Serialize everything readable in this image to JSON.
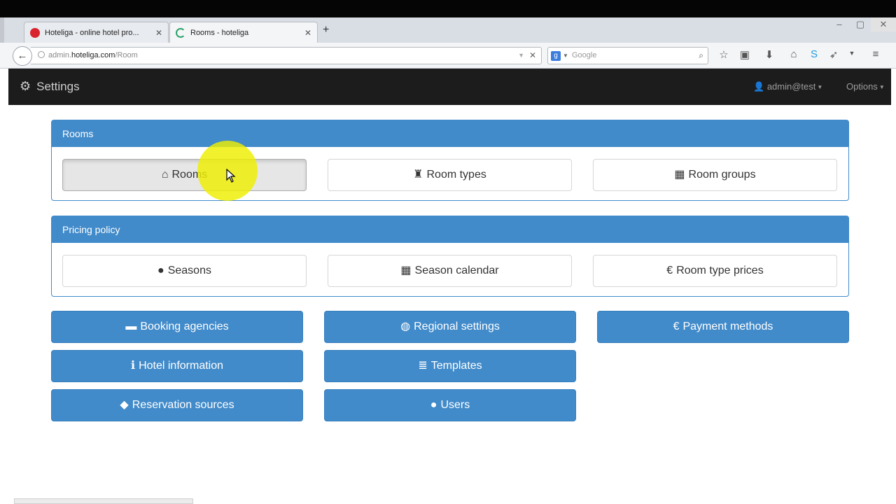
{
  "browser": {
    "tabs": [
      {
        "title": "Hoteliga - online hotel pro...",
        "favicon_color": "#d9232e"
      },
      {
        "title": "Rooms - hoteliga",
        "favicon_color": "#2ca26a"
      }
    ],
    "url_host_prefix": "admin.",
    "url_host": "hoteliga.com",
    "url_path": "/Room",
    "search_placeholder": "Google",
    "search_engine_letter": "g"
  },
  "appnav": {
    "brand": "Settings",
    "user": "admin@test",
    "options": "Options"
  },
  "panels": [
    {
      "title": "Rooms",
      "buttons": [
        {
          "label": "Rooms",
          "icon": "home-icon",
          "glyph": "⌂",
          "state": "pressed"
        },
        {
          "label": "Room types",
          "icon": "chess-rook-icon",
          "glyph": "♜"
        },
        {
          "label": "Room groups",
          "icon": "th-large-icon",
          "glyph": "▦"
        }
      ]
    },
    {
      "title": "Pricing policy",
      "buttons": [
        {
          "label": "Seasons",
          "icon": "circle-icon",
          "glyph": "●"
        },
        {
          "label": "Season calendar",
          "icon": "calendar-icon",
          "glyph": "▦"
        },
        {
          "label": "Room type prices",
          "icon": "euro-icon",
          "glyph": "€"
        }
      ]
    }
  ],
  "settings_buttons": [
    {
      "label": "Booking agencies",
      "icon": "briefcase-icon",
      "glyph": "▬"
    },
    {
      "label": "Regional settings",
      "icon": "globe-icon",
      "glyph": "◍"
    },
    {
      "label": "Payment methods",
      "icon": "euro-icon",
      "glyph": "€"
    },
    {
      "label": "Hotel information",
      "icon": "info-sign-icon",
      "glyph": "ℹ"
    },
    {
      "label": "Templates",
      "icon": "align-left-icon",
      "glyph": "≣"
    },
    {
      "label": "Reservation sources",
      "icon": "tag-icon",
      "glyph": "◆"
    },
    {
      "label": "Users",
      "icon": "user-icon",
      "glyph": "●"
    }
  ],
  "colors": {
    "primary": "#428bca",
    "navbar": "#1c1c1c",
    "highlight": "#eeee00"
  }
}
